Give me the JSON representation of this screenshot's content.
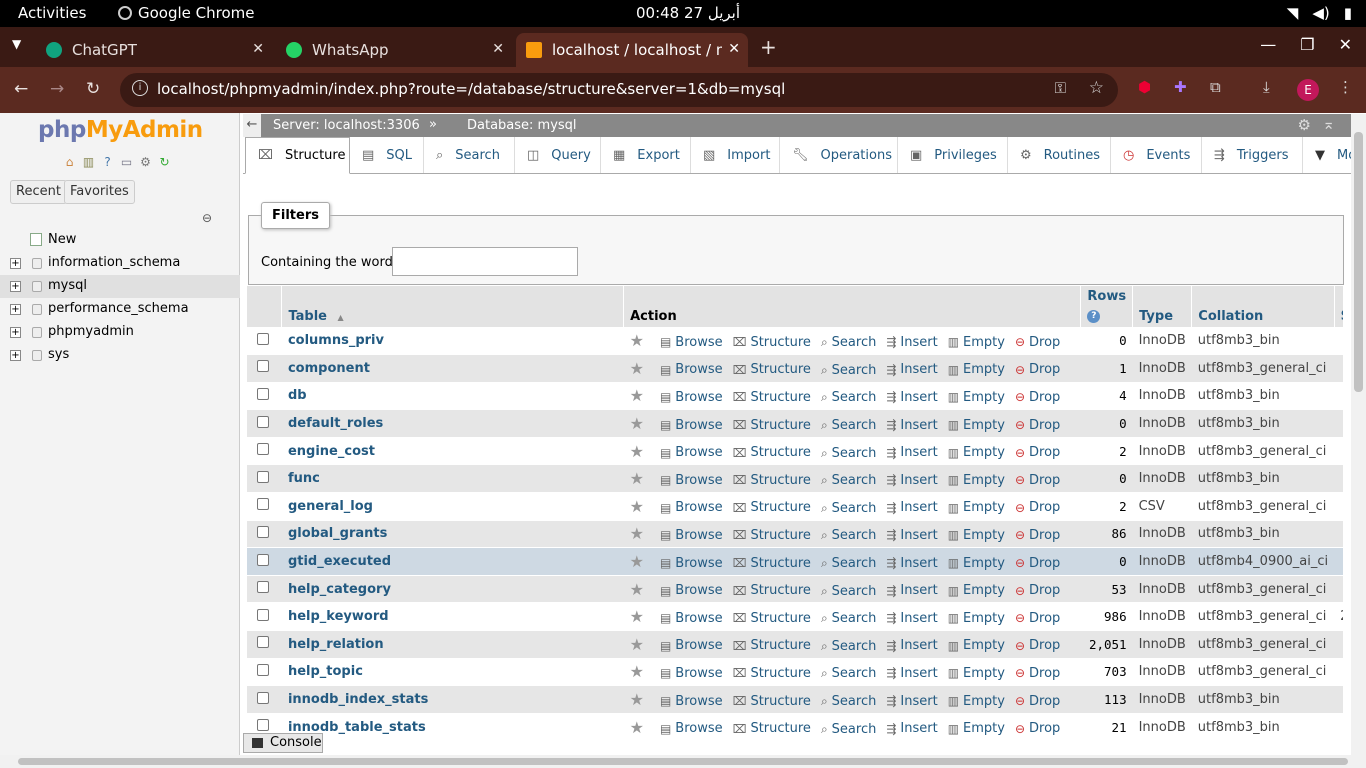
{
  "os_bar": {
    "activities": "Activities",
    "app_name": "Google Chrome",
    "clock": "00:48  27 أبريل"
  },
  "browser": {
    "tabs": [
      {
        "title": "ChatGPT",
        "icon": "chatgpt-icon",
        "active": false
      },
      {
        "title": "WhatsApp",
        "icon": "whatsapp-icon",
        "active": false
      },
      {
        "title": "localhost / localhost / my",
        "icon": "phpmyadmin-icon",
        "active": true
      }
    ],
    "url": "localhost/phpmyadmin/index.php?route=/database/structure&server=1&db=mysql",
    "profile_initial": "E"
  },
  "nav": {
    "logo_php": "php",
    "logo_myadmin": "MyAdmin",
    "recent_label": "Recent",
    "favorites_label": "Favorites",
    "new_label": "New",
    "databases": [
      "information_schema",
      "mysql",
      "performance_schema",
      "phpmyadmin",
      "sys"
    ],
    "selected_db": "mysql"
  },
  "breadcrumb": {
    "server": "Server: localhost:3306",
    "separator": "»",
    "database": "Database: mysql"
  },
  "menu_tabs": [
    {
      "label": "Structure",
      "icon": "structure-icon"
    },
    {
      "label": "SQL",
      "icon": "sql-icon"
    },
    {
      "label": "Search",
      "icon": "search-icon"
    },
    {
      "label": "Query",
      "icon": "query-icon"
    },
    {
      "label": "Export",
      "icon": "export-icon"
    },
    {
      "label": "Import",
      "icon": "import-icon"
    },
    {
      "label": "Operations",
      "icon": "wrench-icon"
    },
    {
      "label": "Privileges",
      "icon": "privileges-icon"
    },
    {
      "label": "Routines",
      "icon": "routines-icon"
    },
    {
      "label": "Events",
      "icon": "events-icon"
    },
    {
      "label": "Triggers",
      "icon": "triggers-icon"
    },
    {
      "label": "Mo",
      "icon": "chevron-down-icon"
    }
  ],
  "filters": {
    "legend": "Filters",
    "containing_label": "Containing the word:",
    "input_value": ""
  },
  "table": {
    "headers": {
      "table": "Table",
      "sort_arrow": "▲",
      "action": "Action",
      "rows": "Rows",
      "type": "Type",
      "collation": "Collation"
    },
    "actions": [
      "Browse",
      "Structure",
      "Search",
      "Insert",
      "Empty",
      "Drop"
    ],
    "rows": [
      {
        "name": "columns_priv",
        "rows": "0",
        "type": "InnoDB",
        "collation": "utf8mb3_bin",
        "extra": ""
      },
      {
        "name": "component",
        "rows": "1",
        "type": "InnoDB",
        "collation": "utf8mb3_general_ci",
        "extra": ""
      },
      {
        "name": "db",
        "rows": "4",
        "type": "InnoDB",
        "collation": "utf8mb3_bin",
        "extra": ""
      },
      {
        "name": "default_roles",
        "rows": "0",
        "type": "InnoDB",
        "collation": "utf8mb3_bin",
        "extra": ""
      },
      {
        "name": "engine_cost",
        "rows": "2",
        "type": "InnoDB",
        "collation": "utf8mb3_general_ci",
        "extra": ""
      },
      {
        "name": "func",
        "rows": "0",
        "type": "InnoDB",
        "collation": "utf8mb3_bin",
        "extra": ""
      },
      {
        "name": "general_log",
        "rows": "2",
        "type": "CSV",
        "collation": "utf8mb3_general_ci",
        "extra": ""
      },
      {
        "name": "global_grants",
        "rows": "86",
        "type": "InnoDB",
        "collation": "utf8mb3_bin",
        "extra": ""
      },
      {
        "name": "gtid_executed",
        "rows": "0",
        "type": "InnoDB",
        "collation": "utf8mb4_0900_ai_ci",
        "extra": ""
      },
      {
        "name": "help_category",
        "rows": "53",
        "type": "InnoDB",
        "collation": "utf8mb3_general_ci",
        "extra": ""
      },
      {
        "name": "help_keyword",
        "rows": "986",
        "type": "InnoDB",
        "collation": "utf8mb3_general_ci",
        "extra": "2"
      },
      {
        "name": "help_relation",
        "rows": "2,051",
        "type": "InnoDB",
        "collation": "utf8mb3_general_ci",
        "extra": ""
      },
      {
        "name": "help_topic",
        "rows": "703",
        "type": "InnoDB",
        "collation": "utf8mb3_general_ci",
        "extra": ""
      },
      {
        "name": "innodb_index_stats",
        "rows": "113",
        "type": "InnoDB",
        "collation": "utf8mb3_bin",
        "extra": ""
      },
      {
        "name": "innodb_table_stats",
        "rows": "21",
        "type": "InnoDB",
        "collation": "utf8mb3_bin",
        "extra": ""
      }
    ],
    "highlighted_row": "gtid_executed"
  },
  "console_label": "Console",
  "colors": {
    "link": "#235a81",
    "logo_php": "#6c78af",
    "logo_admin": "#f89c0e",
    "chrome_frame": "#3a1a14",
    "chrome_toolbar": "#5b2a20"
  }
}
